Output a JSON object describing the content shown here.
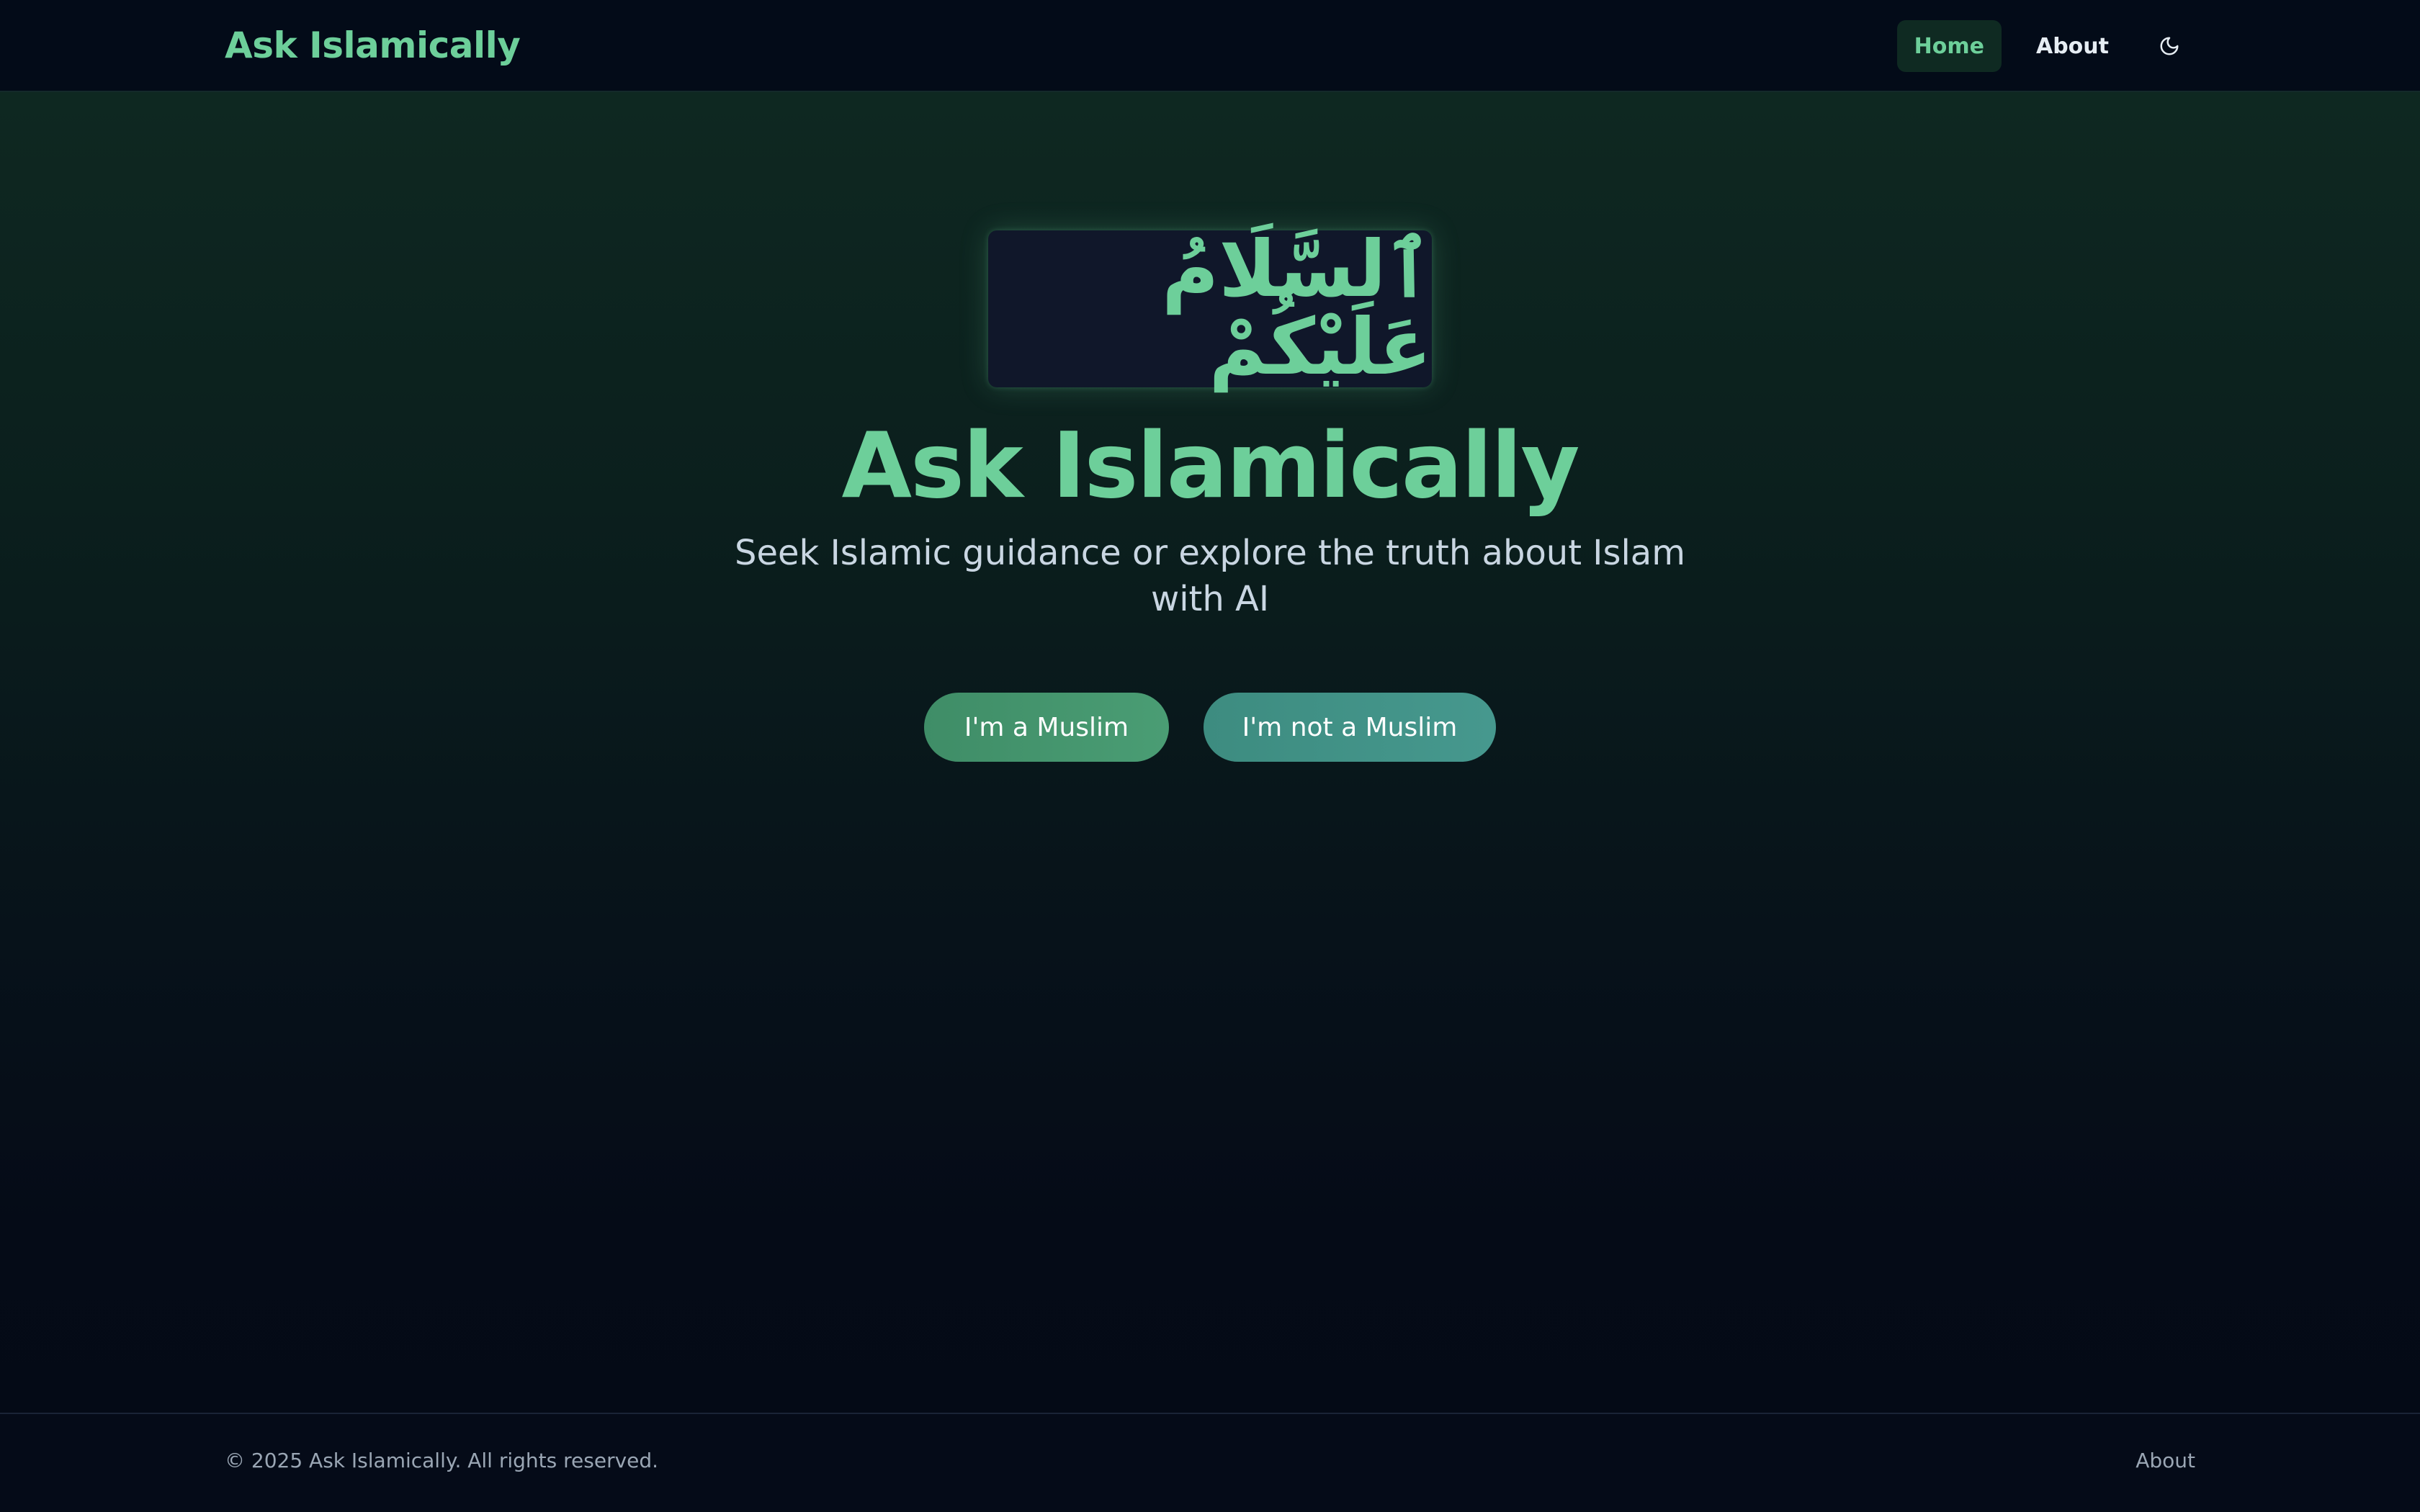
{
  "header": {
    "brand": "Ask Islamically",
    "nav": {
      "home": "Home",
      "about": "About"
    },
    "theme_toggle_icon": "moon-icon"
  },
  "hero": {
    "greeting_arabic": "ٱلسَّلَامُ عَلَيْكُمْ",
    "title": "Ask Islamically",
    "subtitle": "Seek Islamic guidance or explore the truth about Islam with AI",
    "buttons": {
      "muslim": "I'm a Muslim",
      "not_muslim": "I'm not a Muslim"
    }
  },
  "footer": {
    "copyright": "© 2025 Ask Islamically. All rights reserved.",
    "about": "About"
  },
  "colors": {
    "accent": "#6dcf9a",
    "background": "#040a16",
    "header_bg": "#030b18",
    "button_muslim": "#44966e",
    "button_not_muslim": "#419287"
  }
}
